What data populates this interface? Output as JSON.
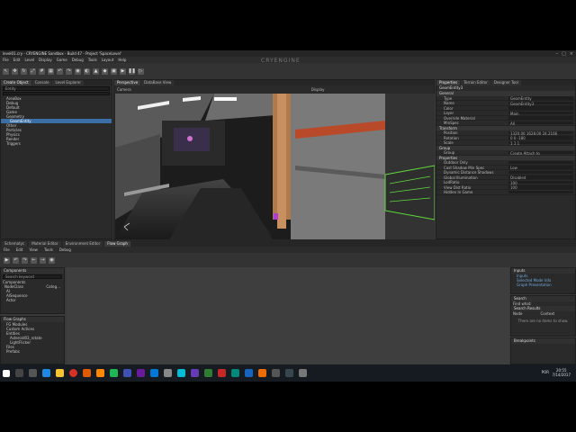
{
  "window": {
    "title": "level01.cry - CRYENGINE Sandbox - Build 47 - Project 'SpaceLevel'",
    "logo": "CRYENGINE"
  },
  "menu": [
    "File",
    "Edit",
    "Level",
    "Display",
    "Game",
    "Debug",
    "Tools",
    "Layout",
    "Help"
  ],
  "left_tabs": [
    "Create Object",
    "Console",
    "Level Explorer"
  ],
  "left_search": "Entity",
  "tree": [
    "AreaBox",
    "Debug",
    "Default",
    "Game",
    "Geometry",
    "GeomEntity",
    "Other",
    "Particles",
    "Physics",
    "Render",
    "Triggers"
  ],
  "tree_selected": "GeomEntity",
  "viewport_tabs": [
    "Perspective",
    "DataBase View"
  ],
  "viewport_label": "Camera",
  "viewport_display": "Display",
  "right_tabs": [
    "Properties",
    "Terrain Editor",
    "Designer Tool"
  ],
  "props_entity": "GeomEntity3",
  "props": [
    {
      "group": "General"
    },
    {
      "k": "Type",
      "v": "GeomEntity"
    },
    {
      "k": "Name",
      "v": "GeomEntity3"
    },
    {
      "k": "Color",
      "v": ""
    },
    {
      "k": "Layer",
      "v": "Main"
    },
    {
      "k": "Override Material",
      "v": ""
    },
    {
      "k": "MinSpec",
      "v": "All"
    },
    {
      "group": "Transform"
    },
    {
      "k": "Position",
      "v": "1320.00   1628.00   24.2166"
    },
    {
      "k": "Rotation",
      "v": "0   0   -180"
    },
    {
      "k": "Scale",
      "v": "1   1   1"
    },
    {
      "group": "Group"
    },
    {
      "k": "Group",
      "v": "Create   Attach to"
    },
    {
      "group": "Properties"
    },
    {
      "k": "Outdoor Only",
      "v": ""
    },
    {
      "k": "Cast Shadow Min Spec",
      "v": "Low"
    },
    {
      "k": "Dynamic Distance Shadows",
      "v": ""
    },
    {
      "k": "Global Illumination",
      "v": "Disabled"
    },
    {
      "k": "LodRatio",
      "v": "100"
    },
    {
      "k": "View Dist Ratio",
      "v": "100"
    },
    {
      "k": "Hidden In Game",
      "v": ""
    }
  ],
  "bottom_tabs": [
    "Schematyc",
    "Material Editor",
    "Environment Editor",
    "Flow Graph"
  ],
  "flow_menu": [
    "File",
    "Edit",
    "View",
    "Tools",
    "Debug"
  ],
  "components": {
    "title": "Components",
    "search": "Search keyword",
    "header": "Components",
    "cols": [
      "NodeClass",
      "Categ..."
    ],
    "items": [
      "AI",
      "AISequence",
      "Actor"
    ]
  },
  "flowgraphs": {
    "title": "Flow Graphs",
    "items": [
      "FG Modules",
      "Custom Actions",
      "Entities",
      "Asteroid03_rotate",
      "LightFlicker",
      "Files",
      "Prefabs"
    ]
  },
  "inputs": {
    "title": "Inputs",
    "items": [
      "Inputs",
      "Selected Mode Info",
      "Graph Presentation"
    ]
  },
  "search_panel": {
    "title": "Search",
    "find_what": "Find what:",
    "results_title": "Search Results",
    "cols": [
      "Node",
      "Context"
    ],
    "empty": "There are no items to show."
  },
  "breakpoints": "Breakpoints",
  "clock": {
    "time": "20:55",
    "date": "7/14/2017",
    "lang": "POR"
  }
}
